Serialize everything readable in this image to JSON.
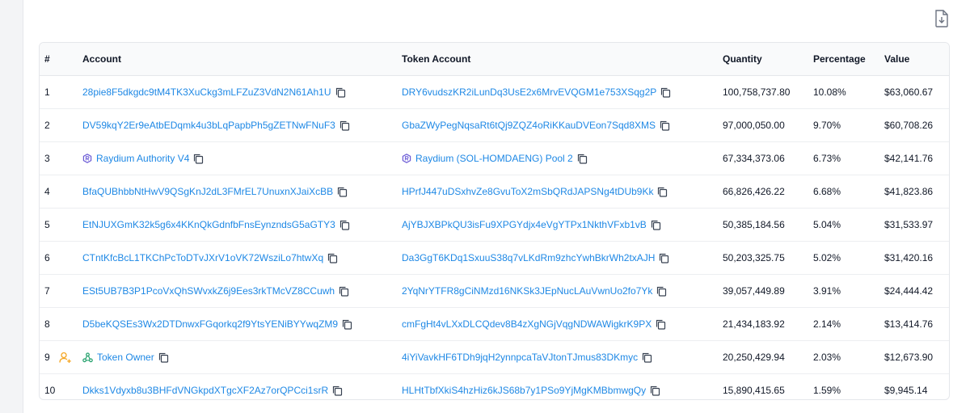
{
  "headers": {
    "rank": "#",
    "account": "Account",
    "token_account": "Token Account",
    "quantity": "Quantity",
    "percentage": "Percentage",
    "value": "Value"
  },
  "rows": [
    {
      "rank": "1",
      "account": "28pie8F5dkgdc9tM4TK3XuCkg3mLFZuZ3VdN2N61Ah1U",
      "token_account": "DRY6vudszKR2iLunDq3UsE2x6MrvEVQGM1e753XSqg2P",
      "quantity": "100,758,737.80",
      "percentage": "10.08%",
      "value": "$63,060.67"
    },
    {
      "rank": "2",
      "account": "DV59kqY2Er9eAtbEDqmk4u3bLqPapbPh5gZETNwFNuF3",
      "token_account": "GbaZWyPegNqsaRt6tQj9ZQZ4oRiKKauDVEon7Sqd8XMS",
      "quantity": "97,000,050.00",
      "percentage": "9.70%",
      "value": "$60,708.26"
    },
    {
      "rank": "3",
      "account": "Raydium Authority V4",
      "token_account": "Raydium (SOL-HOMDAENG) Pool 2",
      "quantity": "67,334,373.06",
      "percentage": "6.73%",
      "value": "$42,141.76",
      "account_icon": "raydium-icon",
      "token_icon": "raydium-icon"
    },
    {
      "rank": "4",
      "account": "BfaQUBhbbNtHwV9QSgKnJ2dL3FMrEL7UnuxnXJaiXcBB",
      "token_account": "HPrfJ447uDSxhvZe8GvuToX2mSbQRdJAPSNg4tDUb9Kk",
      "quantity": "66,826,426.22",
      "percentage": "6.68%",
      "value": "$41,823.86"
    },
    {
      "rank": "5",
      "account": "EtNJUXGmK32k5g6x4KKnQkGdnfbFnsEynzndsG5aGTY3",
      "token_account": "AjYBJXBPkQU3isFu9XPGYdjx4eVgYTPx1NkthVFxb1vB",
      "quantity": "50,385,184.56",
      "percentage": "5.04%",
      "value": "$31,533.97"
    },
    {
      "rank": "6",
      "account": "CTntKfcBcL1TKChPcToDTvJXrV1oVK72WsziLo7htwXq",
      "token_account": "Da3GgT6KDq1SxuuS38q7vLKdRm9zhcYwhBkrWh2txAJH",
      "quantity": "50,203,325.75",
      "percentage": "5.02%",
      "value": "$31,420.16"
    },
    {
      "rank": "7",
      "account": "ESt5UB7B3P1PcoVxQhSWvxkZ6j9Ees3rkTMcVZ8CCuwh",
      "token_account": "2YqNrYTFR8gCiNMzd16NKSk3JEpNucLAuVwnUo2fo7Yk",
      "quantity": "39,057,449.89",
      "percentage": "3.91%",
      "value": "$24,444.42"
    },
    {
      "rank": "8",
      "account": "D5beKQSEs3Wx2DTDnwxFGqorkq2f9YtsYENiBYYwqZM9",
      "token_account": "cmFgHt4vLXxDLCQdev8B4zXgNGjVqgNDWAWigkrK9PX",
      "quantity": "21,434,183.92",
      "percentage": "2.14%",
      "value": "$13,414.76"
    },
    {
      "rank": "9",
      "account": "Token Owner",
      "token_account": "4iYiVavkHF6TDh9jqH2ynnpcaTaVJtonTJmus83DKmyc",
      "quantity": "20,250,429.94",
      "percentage": "2.03%",
      "value": "$12,673.90",
      "account_icon": "token-owner-icon",
      "rank_badge": "add-user-icon"
    },
    {
      "rank": "10",
      "account": "Dkks1Vdyxb8u3BHFdVNGkpdXTgcXF2Az7orQPCci1srR",
      "token_account": "HLHtTbfXkiS4hzHiz6kJS68b7y1PSo9YjMgKMBbmwgQy",
      "quantity": "15,890,415.65",
      "percentage": "1.59%",
      "value": "$9,945.14"
    }
  ],
  "icons": {
    "export": "download-file-icon",
    "copy": "copy-icon"
  },
  "colors": {
    "link": "#1e88e5",
    "owner_badge": "#f5a623",
    "raydium": "#6b5bd6",
    "token_owner": "#22a06b"
  }
}
